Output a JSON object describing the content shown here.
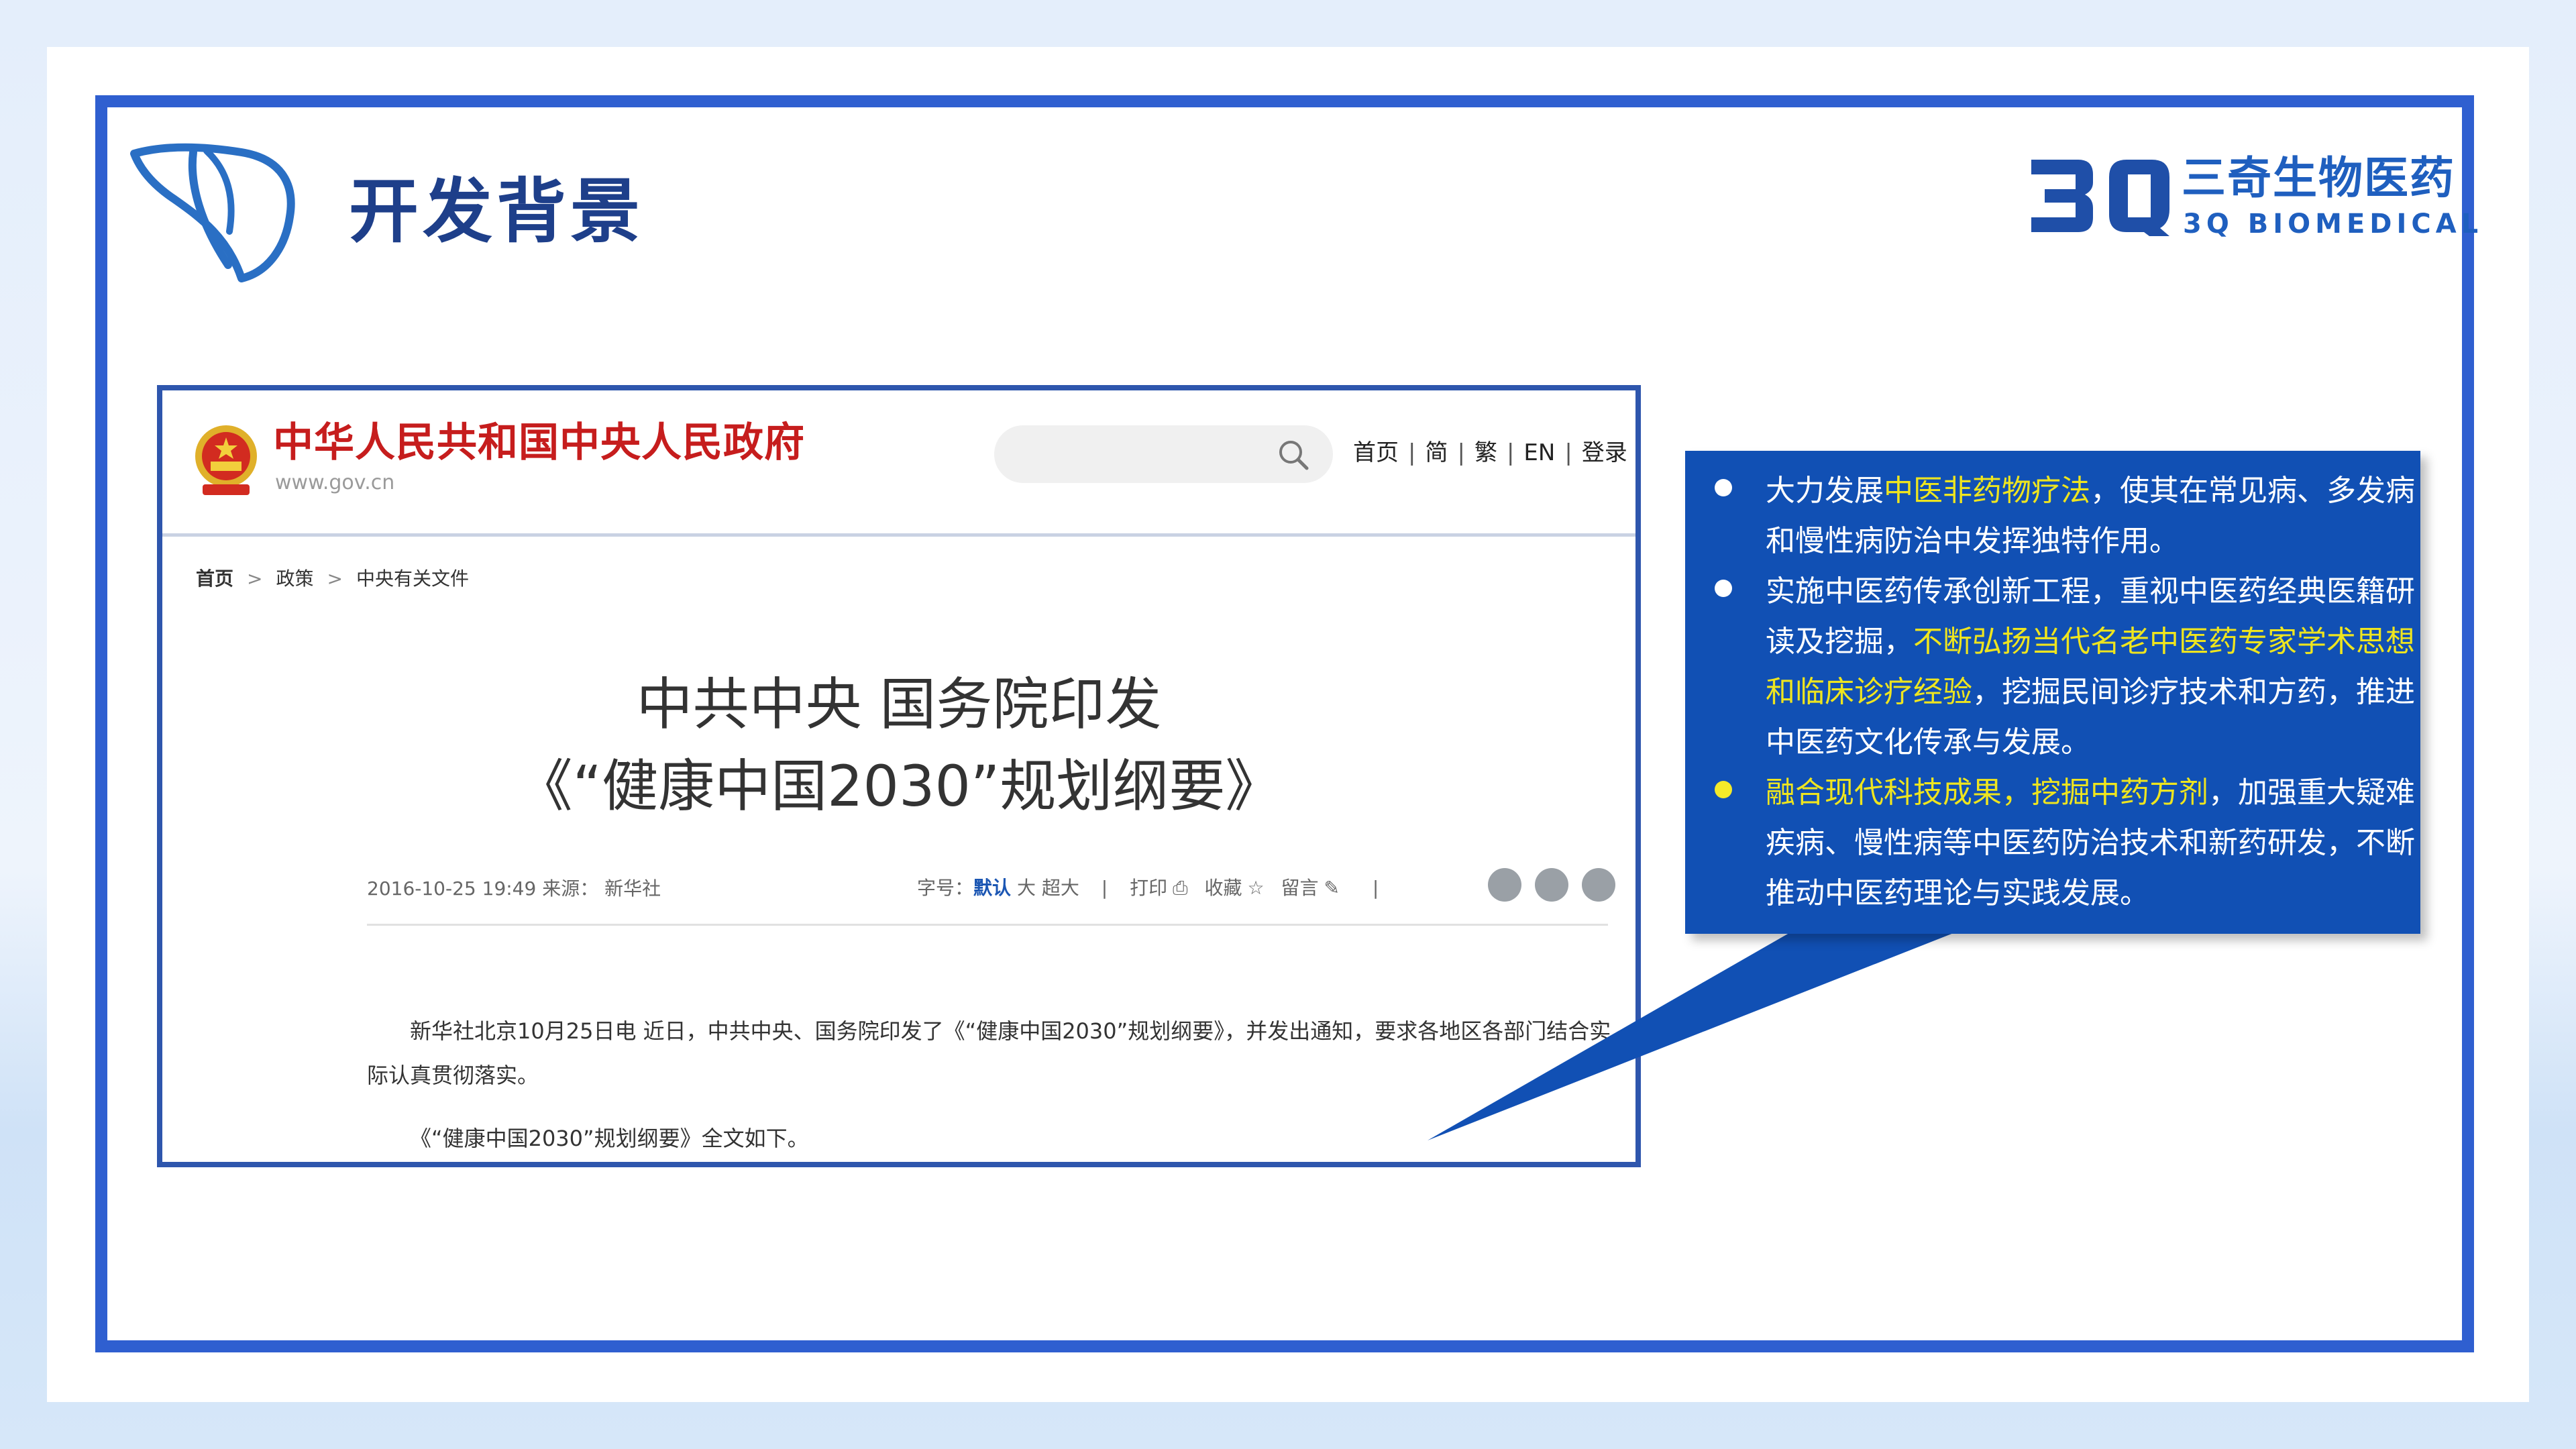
{
  "slide": {
    "title": "开发背景",
    "brand": {
      "mark": "3Q",
      "name_cn": "三奇生物医药",
      "name_en": "3Q BIOMEDICAL"
    }
  },
  "screenshot": {
    "site_name": "中华人民共和国中央人民政府",
    "site_url": "www.gov.cn",
    "search_placeholder": "",
    "nav": [
      "首页",
      "简",
      "繁",
      "EN",
      "登录"
    ],
    "nav_sep": "|",
    "breadcrumb": [
      "首页",
      "政策",
      "中央有关文件"
    ],
    "breadcrumb_sep": ">",
    "article_title_line1": "中共中央 国务院印发",
    "article_title_line2": "《“健康中国2030”规划纲要》",
    "meta": "2016-10-25 19:49  来源： 新华社",
    "tools": {
      "font_label": "字号：",
      "font_default": "默认",
      "font_large": "大",
      "font_xlarge": "超大",
      "sep": "|",
      "print": "打印",
      "favorite": "收藏",
      "comment": "留言"
    },
    "share_icons": [
      "weibo-icon",
      "wechat-icon",
      "star-icon"
    ],
    "paragraph1": "新华社北京10月25日电 近日，中共中央、国务院印发了《“健康中国2030”规划纲要》，并发出通知，要求各地区各部门结合实际认真贯彻落实。",
    "paragraph2": "《“健康中国2030”规划纲要》全文如下。"
  },
  "callout": {
    "bullets": [
      {
        "parts": [
          {
            "t": "大力发展",
            "hl": false
          },
          {
            "t": "中医非药物疗法",
            "hl": true
          },
          {
            "t": "，使其在常见病、多发病和慢性病防治中发挥独特作用。",
            "hl": false
          }
        ],
        "dot": "white"
      },
      {
        "parts": [
          {
            "t": "实施中医药传承创新工程，重视中医药经典医籍研读及挖掘，",
            "hl": false
          },
          {
            "t": "不断弘扬当代名老中医药专家学术思想和临床诊疗经验",
            "hl": true
          },
          {
            "t": "，挖掘民间诊疗技术和方药，推进中医药文化传承与发展。",
            "hl": false
          }
        ],
        "dot": "white"
      },
      {
        "parts": [
          {
            "t": "融合现代科技成果，挖掘中药方剂",
            "hl": true
          },
          {
            "t": "，加强重大疑难疾病、慢性病等中医药防治技术和新药研发，不断推动中医药理论与实践发展。",
            "hl": false
          }
        ],
        "dot": "yellow"
      }
    ],
    "colors": {
      "background": "#1150b4",
      "highlight": "#eee51f",
      "text": "#ffffff"
    }
  },
  "colors": {
    "frame": "#2f5fd0",
    "title": "#1e3f8a",
    "brand": "#1f5fbf",
    "gov_red": "#c61d1d"
  }
}
